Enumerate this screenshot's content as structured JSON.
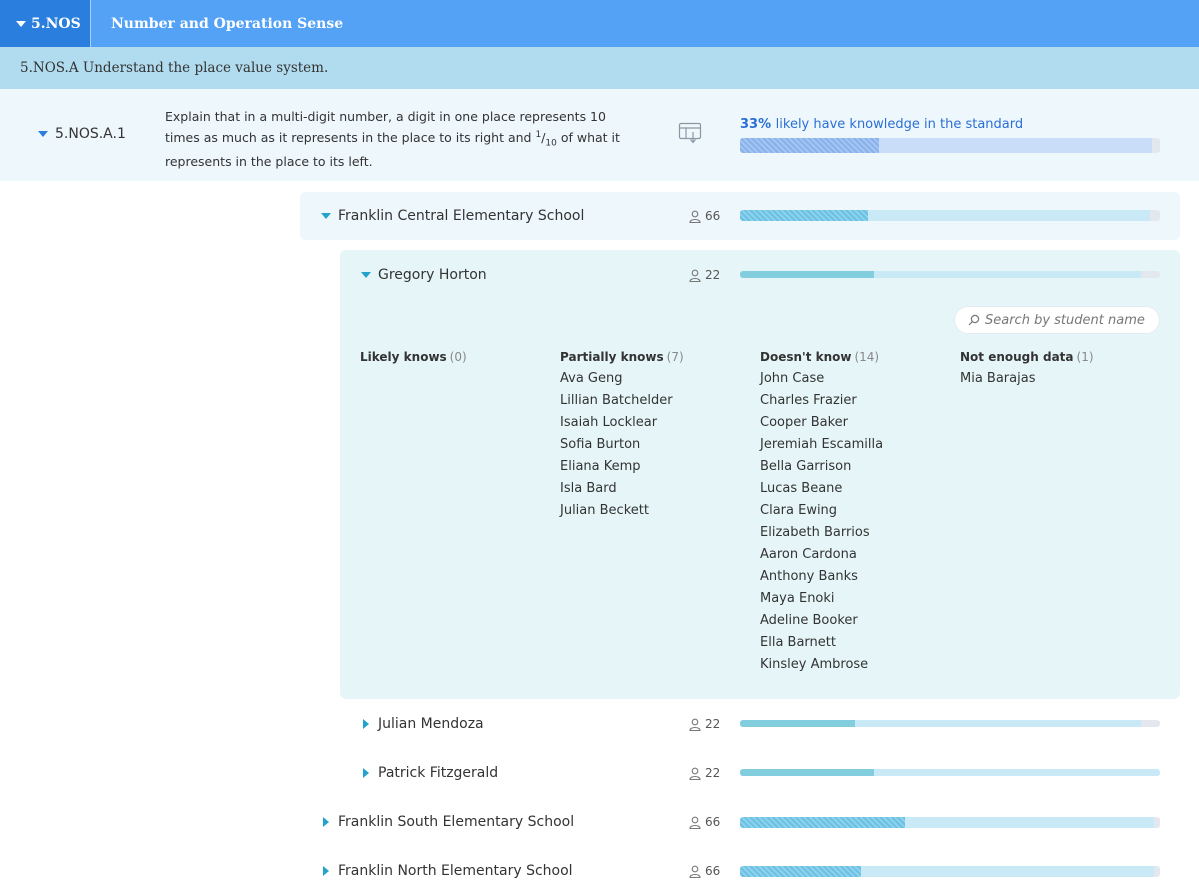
{
  "header": {
    "code": "5.NOS",
    "title": "Number and Operation Sense"
  },
  "cluster": {
    "label": "5.NOS.A Understand the place value system."
  },
  "standard": {
    "code": "5.NOS.A.1",
    "desc_part1": "Explain that in a multi-digit number, a digit in one place represents 10 times as much as it represents in the place to its right and ",
    "frac_num": "1",
    "frac_den": "10",
    "desc_part2": " of what it represents in the place to its left.",
    "percent": "33%",
    "percent_text": "likely have knowledge in the standard",
    "progress": 0.33,
    "bar_total": 0.98
  },
  "search": {
    "placeholder": "Search by student name"
  },
  "rows": {
    "central": {
      "name": "Franklin Central Elementary School",
      "count": "66",
      "progress": 0.305,
      "bar_total": 0.976
    },
    "horton": {
      "name": "Gregory Horton",
      "count": "22",
      "progress": 0.318,
      "bar_total": 0.955
    },
    "mendoza": {
      "name": "Julian Mendoza",
      "count": "22",
      "progress": 0.273,
      "bar_total": 0.955
    },
    "fitzgerald": {
      "name": "Patrick Fitzgerald",
      "count": "22",
      "progress": 0.318,
      "bar_total": 1.0
    },
    "south": {
      "name": "Franklin South Elementary School",
      "count": "66",
      "progress": 0.394,
      "bar_total": 0.985
    },
    "north": {
      "name": "Franklin North Elementary School",
      "count": "66",
      "progress": 0.288,
      "bar_total": 0.985
    }
  },
  "columns": {
    "likely": {
      "title": "Likely knows",
      "count": "(0)",
      "names": []
    },
    "partial": {
      "title": "Partially knows",
      "count": "(7)",
      "names": [
        "Ava Geng",
        "Lillian Batchelder",
        "Isaiah Locklear",
        "Sofia Burton",
        "Eliana Kemp",
        "Isla Bard",
        "Julian Beckett"
      ]
    },
    "doesnt": {
      "title": "Doesn't know",
      "count": "(14)",
      "names": [
        "John Case",
        "Charles Frazier",
        "Cooper Baker",
        "Jeremiah Escamilla",
        "Bella Garrison",
        "Lucas Beane",
        "Clara Ewing",
        "Elizabeth Barrios",
        "Aaron Cardona",
        "Anthony Banks",
        "Maya Enoki",
        "Adeline Booker",
        "Ella Barnett",
        "Kinsley Ambrose"
      ]
    },
    "notenough": {
      "title": "Not enough data",
      "count": "(1)",
      "names": [
        "Mia Barajas"
      ]
    }
  },
  "colors": {
    "header_bg": "#54a2f5",
    "header_tab_bg": "#2a7fde",
    "cluster_bg": "#b1dcef",
    "standard_bar_fill": "#8fb8f2",
    "standard_bar_track": "#c9dcf8",
    "school_bar_fill": "#71c8ea",
    "school_bar_track": "#c8e9f5",
    "teacher_bar_fill": "#82cede",
    "teacher_bar_track": "#c8e9f5"
  }
}
